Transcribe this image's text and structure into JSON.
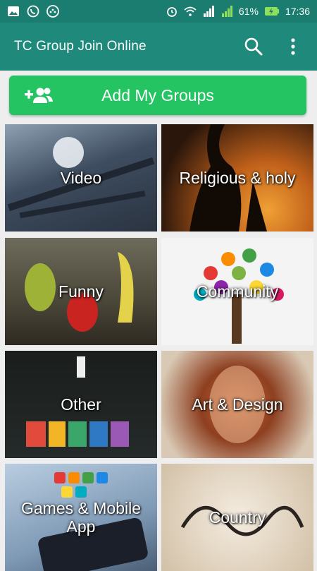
{
  "status_bar": {
    "battery": "61%",
    "time": "17:36",
    "icons": [
      "image-icon",
      "whatsapp-icon",
      "dots-app-icon",
      "alarm-icon",
      "wifi-icon",
      "signal-1-icon",
      "signal-2-icon",
      "battery-charging-icon"
    ]
  },
  "app_bar": {
    "title": "TC Group Join Online",
    "actions": [
      "search-icon",
      "more-vert-icon"
    ],
    "color": "#1f8a7c"
  },
  "add_button": {
    "label": "Add My Groups",
    "icon": "add-group-icon",
    "color": "#25c463"
  },
  "categories": [
    {
      "label": "Video"
    },
    {
      "label": "Religious & holy"
    },
    {
      "label": "Funny"
    },
    {
      "label": "Community"
    },
    {
      "label": "Other"
    },
    {
      "label": "Art & Design"
    },
    {
      "label": "Games & Mobile App"
    },
    {
      "label": "Country"
    }
  ]
}
